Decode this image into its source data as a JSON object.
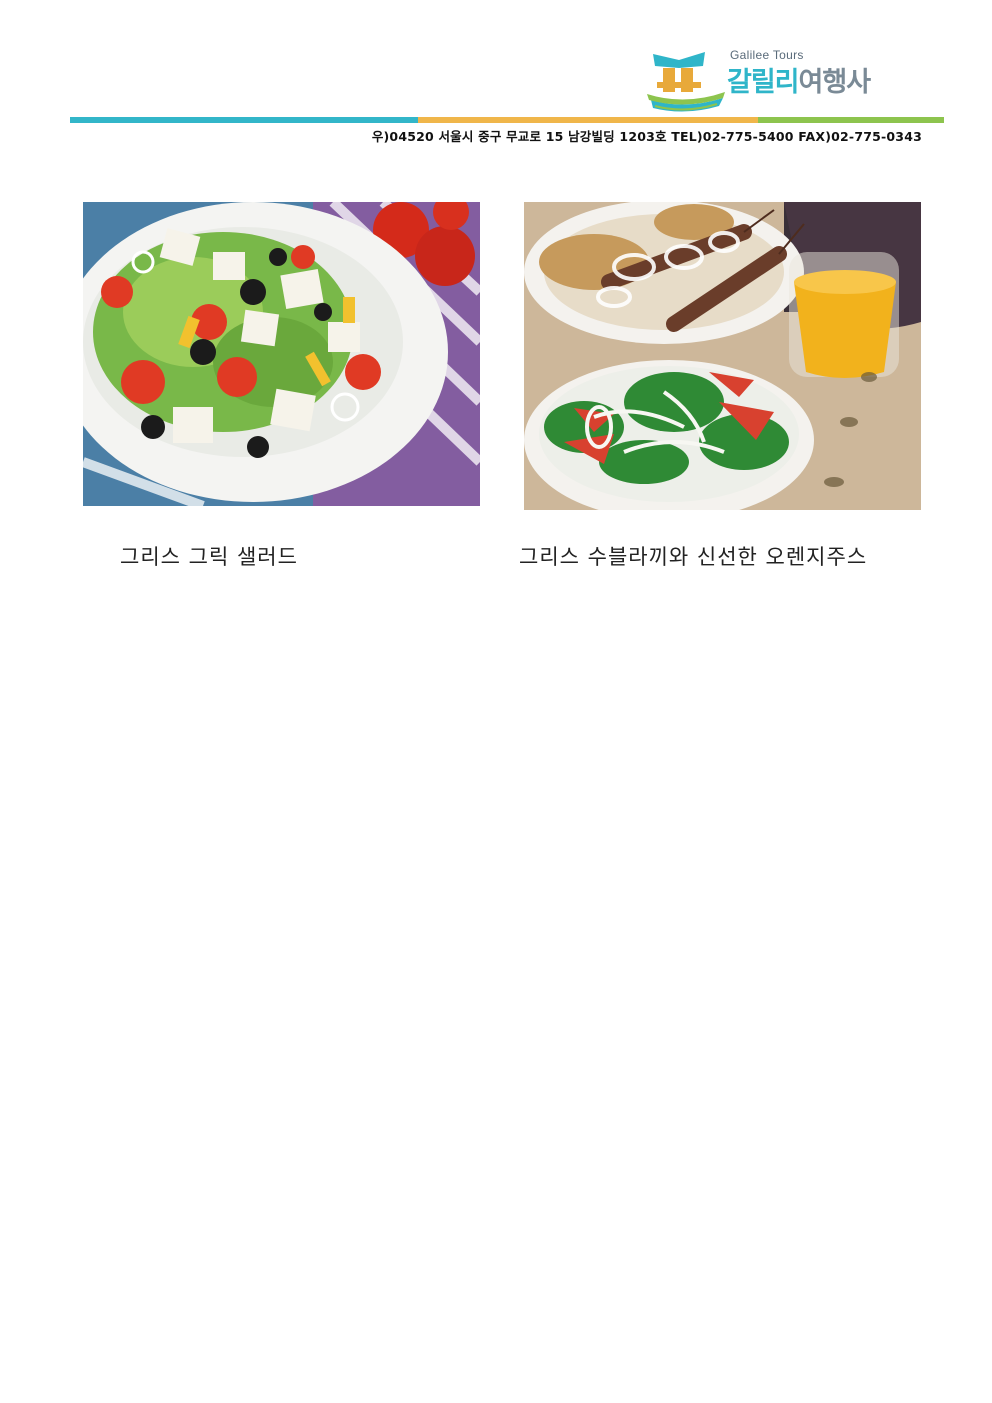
{
  "header": {
    "logo_en": "Galilee Tours",
    "logo_ko_part1": "갈릴리",
    "logo_ko_part2": "여행사",
    "address": "우)04520 서울시 중구 무교로 15 남강빌딩 1203호 TEL)02-775-5400 FAX)02-775-0343",
    "colors": {
      "teal": "#32b6c9",
      "orange": "#f0b64a",
      "green": "#8dc44e"
    }
  },
  "photos": [
    {
      "icon": "greek-salad-photo",
      "caption": "그리스 그릭 샐러드"
    },
    {
      "icon": "souvlaki-orange-juice-photo",
      "caption": "그리스 수블라끼와 신선한 오렌지주스"
    }
  ]
}
